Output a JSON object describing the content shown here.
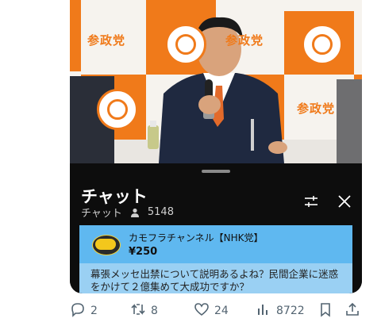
{
  "chat": {
    "title": "チャット",
    "subtitle": "チャット",
    "viewer_count": "5148"
  },
  "pinned": {
    "author": "カモフラチャンネル【NHK党】",
    "amount": "¥250",
    "message": "幕張メッセ出禁について説明あるよね？民間企業に迷惑をかけて２億集めて大成功ですか？"
  },
  "backdrop": {
    "logo_text": "参政党"
  },
  "actions": {
    "replies": "2",
    "reposts": "8",
    "likes": "24",
    "views": "8722"
  },
  "colors": {
    "accent_orange": "#f07a1a",
    "pinned_header": "#5fb8f0",
    "pinned_body": "#9ad0f3",
    "chat_bg": "#0d0d0d",
    "action_gray": "#536471"
  }
}
